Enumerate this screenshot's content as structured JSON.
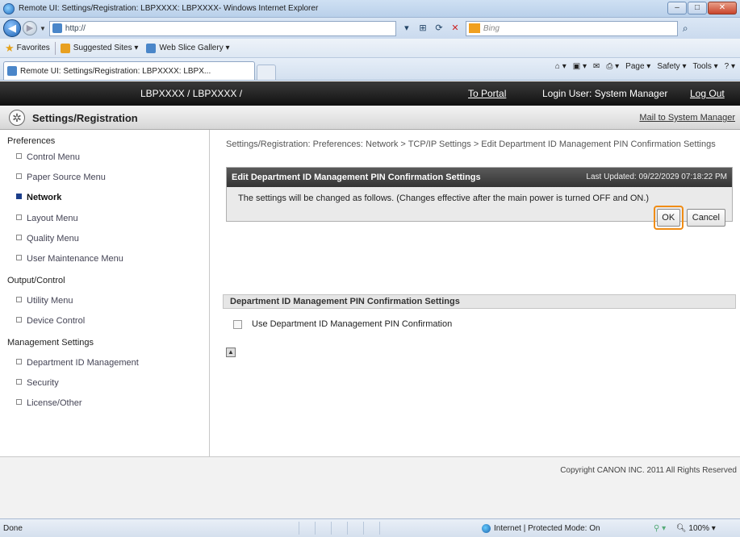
{
  "browser": {
    "window_title": "Remote UI: Settings/Registration: LBPXXXX: LBPXXXX- Windows Internet Explorer",
    "window_buttons": {
      "minimize": "–",
      "maximize": "□",
      "close": "✕"
    },
    "address": "http://",
    "search_placeholder": "Bing",
    "favorites_label": "Favorites",
    "favorites_items": [
      "Suggested Sites ▾",
      "Web Slice Gallery ▾"
    ],
    "tab_title": "Remote UI: Settings/Registration: LBPXXXX: LBPX...",
    "command_bar": [
      "Page ▾",
      "Safety ▾",
      "Tools ▾",
      "? ▾"
    ],
    "status": {
      "left": "Done",
      "zone": "Internet | Protected Mode: On",
      "zoom": "100%"
    }
  },
  "topbar": {
    "device": "LBPXXXX / LBPXXXX /",
    "portal_link": "To Portal",
    "login": "Login User: System Manager",
    "logout": "Log Out"
  },
  "header": {
    "title": "Settings/Registration",
    "mail_link": "Mail to System Manager"
  },
  "sidebar": {
    "sections": [
      {
        "label": "Preferences",
        "items": [
          "Control Menu",
          "Paper Source Menu",
          "Network",
          "Layout Menu",
          "Quality Menu",
          "User Maintenance Menu"
        ]
      },
      {
        "label": "Output/Control",
        "items": [
          "Utility Menu",
          "Device Control"
        ]
      },
      {
        "label": "Management Settings",
        "items": [
          "Department ID Management",
          "Security",
          "License/Other"
        ]
      }
    ],
    "active": "Network"
  },
  "main": {
    "breadcrumb": "Settings/Registration: Preferences: Network > TCP/IP Settings > Edit Department ID Management PIN Confirmation Settings",
    "panel_title": "Edit Department ID Management PIN Confirmation Settings",
    "last_updated": "Last Updated: 09/22/2029 07:18:22 PM",
    "message": "The settings will be changed as follows. (Changes effective after the main power is turned OFF and ON.)",
    "ok_label": "OK",
    "cancel_label": "Cancel",
    "settings_header": "Department ID Management PIN Confirmation Settings",
    "checkbox_label": "Use Department ID Management PIN Confirmation",
    "checkbox_checked": false
  },
  "footer": {
    "copyright": "Copyright CANON INC. 2011 All Rights Reserved"
  }
}
